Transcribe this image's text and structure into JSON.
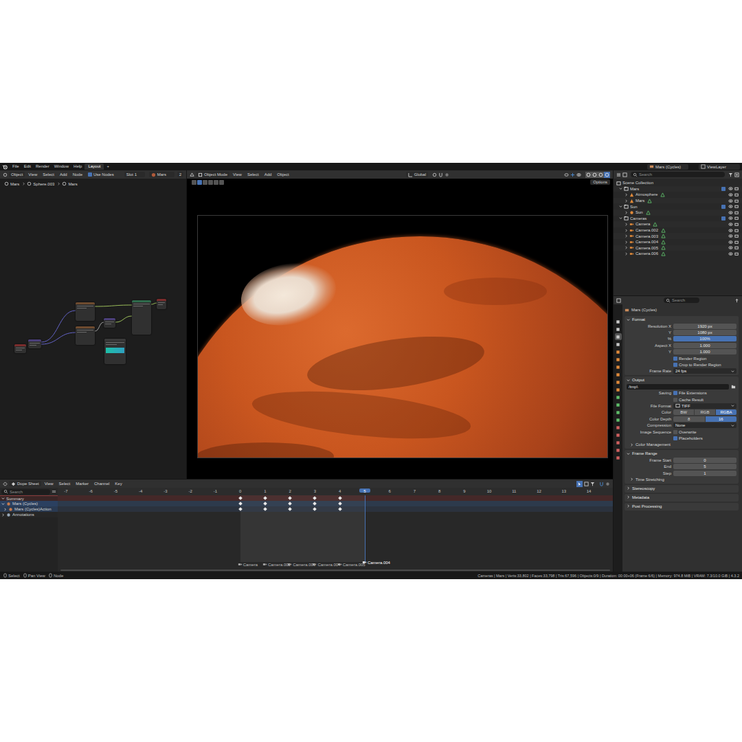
{
  "topbar": {
    "menus": [
      "File",
      "Edit",
      "Render",
      "Window",
      "Help"
    ],
    "workspace_tabs": [
      {
        "label": "Layout",
        "selected": true
      }
    ],
    "add_tab": "+",
    "scene": "Mars (Cycles)",
    "view_layer": "ViewLayer"
  },
  "node_editor": {
    "header": {
      "mode": "Object",
      "menus": [
        "View",
        "Select",
        "Add",
        "Node"
      ],
      "use_nodes": {
        "label": "Use Nodes",
        "checked": true
      },
      "slot": "Slot 1",
      "material": "Mars",
      "users": "2"
    },
    "breadcrumb": [
      "Mars",
      "Sphere.003",
      "Mars"
    ],
    "nodes": [
      {
        "color": "#6e4b2f"
      },
      {
        "color": "#6e4b2f"
      },
      {
        "color": "#4b3f7a"
      },
      {
        "color": "#2f6b4c"
      },
      {
        "color": "#7a2c2c"
      },
      {
        "color": "#4b3f7a"
      },
      {
        "color": "#7a2c2c"
      },
      {
        "color": "#3a3a3a"
      }
    ],
    "links": [
      {
        "color": "#9bbd5a"
      },
      {
        "color": "#6363c7"
      },
      {
        "color": "#6363c7"
      },
      {
        "color": "#a1a1a1"
      },
      {
        "color": "#9bbd5a"
      },
      {
        "color": "#9bbd5a"
      }
    ]
  },
  "viewport": {
    "header": {
      "mode": "Object Mode",
      "menus": [
        "View",
        "Select",
        "Add",
        "Object"
      ],
      "orientation": "Global"
    },
    "options": "Options",
    "shading": [
      {
        "selected": false
      },
      {
        "selected": false
      },
      {
        "selected": false
      },
      {
        "selected": true
      }
    ]
  },
  "outliner": {
    "search": {
      "placeholder": "Search"
    },
    "root": "Scene Collection",
    "items": [
      {
        "label": "Mars",
        "kind": "collection",
        "depth": 0,
        "expanded": true
      },
      {
        "label": "Atmosphere",
        "kind": "mesh",
        "depth": 1,
        "expanded": false
      },
      {
        "label": "Mars",
        "kind": "mesh",
        "depth": 1,
        "expanded": false
      },
      {
        "label": "Sun",
        "kind": "collection",
        "depth": 0,
        "expanded": true
      },
      {
        "label": "Sun",
        "kind": "light",
        "depth": 1,
        "expanded": false
      },
      {
        "label": "Cameras",
        "kind": "collection",
        "depth": 0,
        "expanded": true
      },
      {
        "label": "Camera",
        "kind": "camera",
        "depth": 1,
        "expanded": false
      },
      {
        "label": "Camera.002",
        "kind": "camera",
        "depth": 1,
        "expanded": false
      },
      {
        "label": "Camera.003",
        "kind": "camera",
        "depth": 1,
        "expanded": false
      },
      {
        "label": "Camera.004",
        "kind": "camera",
        "depth": 1,
        "expanded": false
      },
      {
        "label": "Camera.005",
        "kind": "camera",
        "depth": 1,
        "expanded": false
      },
      {
        "label": "Camera.006",
        "kind": "camera",
        "depth": 1,
        "expanded": false
      }
    ]
  },
  "properties": {
    "search": {
      "placeholder": "Search"
    },
    "title": "Mars (Cycles)",
    "tabs": [
      {
        "selected": false
      },
      {
        "selected": false
      },
      {
        "selected": true
      },
      {
        "selected": false
      },
      {
        "selected": false
      },
      {
        "selected": false
      },
      {
        "selected": false
      },
      {
        "selected": false
      },
      {
        "selected": false
      },
      {
        "selected": false
      },
      {
        "selected": false
      },
      {
        "selected": false
      },
      {
        "selected": false
      },
      {
        "selected": false
      },
      {
        "selected": false
      },
      {
        "selected": false
      },
      {
        "selected": false
      },
      {
        "selected": false
      },
      {
        "selected": false
      }
    ],
    "sections": [
      {
        "title": "Format",
        "expanded": true,
        "rows": [
          {
            "kind": "field",
            "label": "Resolution X",
            "value": "1920 px"
          },
          {
            "kind": "field",
            "label": "Y",
            "value": "1080 px"
          },
          {
            "kind": "slider",
            "label": "%",
            "value": "100%",
            "level": 1
          },
          {
            "kind": "field",
            "label": "Aspect X",
            "value": "1.000"
          },
          {
            "kind": "field",
            "label": "Y",
            "value": "1.000"
          },
          {
            "kind": "check",
            "label": "",
            "text": "Render Region",
            "checked": true
          },
          {
            "kind": "check",
            "label": "",
            "text": "Crop to Render Region",
            "checked": true
          },
          {
            "kind": "select",
            "label": "Frame Rate",
            "value": "24 fps"
          }
        ]
      },
      {
        "title": "Output",
        "expanded": true,
        "rows": [
          {
            "kind": "path",
            "label": "",
            "value": "/tmp\\"
          },
          {
            "kind": "check",
            "label": "Saving",
            "text": "File Extensions",
            "checked": true
          },
          {
            "kind": "check",
            "label": "",
            "text": "Cache Result",
            "checked": false
          },
          {
            "kind": "select",
            "label": "File Format",
            "value": "TIFF"
          },
          {
            "kind": "toggle",
            "label": "Color",
            "options": [
              {
                "label": "BW",
                "selected": false
              },
              {
                "label": "RGB",
                "selected": false
              },
              {
                "label": "RGBA",
                "selected": true
              }
            ]
          },
          {
            "kind": "toggle",
            "label": "Color Depth",
            "options": [
              {
                "label": "8",
                "selected": false
              },
              {
                "label": "16",
                "selected": true
              }
            ]
          },
          {
            "kind": "select",
            "label": "Compression",
            "value": "None"
          },
          {
            "kind": "check",
            "label": "Image Sequence",
            "text": "Overwrite",
            "checked": false
          },
          {
            "kind": "check",
            "label": "",
            "text": "Placeholders",
            "checked": true
          },
          {
            "kind": "sub",
            "label": "Color Management",
            "expanded": false
          }
        ]
      },
      {
        "title": "Frame Range",
        "expanded": true,
        "rows": [
          {
            "kind": "field",
            "label": "Frame Start",
            "value": "0"
          },
          {
            "kind": "field",
            "label": "End",
            "value": "5"
          },
          {
            "kind": "field",
            "label": "Step",
            "value": "1"
          },
          {
            "kind": "sub",
            "label": "Time Stretching",
            "expanded": false
          }
        ]
      },
      {
        "title": "Stereoscopy",
        "expanded": false,
        "rows": []
      },
      {
        "title": "Metadata",
        "expanded": false,
        "rows": []
      },
      {
        "title": "Post Processing",
        "expanded": false,
        "rows": []
      }
    ]
  },
  "dope_sheet": {
    "header": {
      "mode": "Dope Sheet",
      "menus": [
        "View",
        "Select",
        "Marker",
        "Channel",
        "Key"
      ]
    },
    "search": {
      "placeholder": "Search"
    },
    "frames": [
      {
        "label": "-7",
        "selected": false
      },
      {
        "label": "-6",
        "selected": false
      },
      {
        "label": "-5",
        "selected": false
      },
      {
        "label": "-4",
        "selected": false
      },
      {
        "label": "-3",
        "selected": false
      },
      {
        "label": "-2",
        "selected": false
      },
      {
        "label": "-1",
        "selected": false
      },
      {
        "label": "0",
        "selected": false
      },
      {
        "label": "1",
        "selected": false
      },
      {
        "label": "2",
        "selected": false
      },
      {
        "label": "3",
        "selected": false
      },
      {
        "label": "4",
        "selected": false
      },
      {
        "label": "5",
        "selected": true
      },
      {
        "label": "6",
        "selected": false
      },
      {
        "label": "7",
        "selected": false
      },
      {
        "label": "8",
        "selected": false
      },
      {
        "label": "9",
        "selected": false
      },
      {
        "label": "10",
        "selected": false
      },
      {
        "label": "11",
        "selected": false
      },
      {
        "label": "12",
        "selected": false
      },
      {
        "label": "13",
        "selected": false
      },
      {
        "label": "14",
        "selected": false
      }
    ],
    "frame_range": {
      "start": 0,
      "end": 5
    },
    "channels": [
      {
        "label": "Summary",
        "kind": "summary",
        "expanded": true,
        "keys": [
          0,
          1,
          2,
          3,
          4
        ]
      },
      {
        "label": "Mars (Cycles)",
        "kind": "object",
        "expanded": true,
        "keys": [
          0,
          1,
          2,
          3,
          4
        ]
      },
      {
        "label": "Mars (Cycles)Action",
        "kind": "action",
        "expanded": false,
        "keys": [
          0,
          1,
          2,
          3,
          4
        ]
      },
      {
        "label": "Annotations",
        "kind": "annotations",
        "expanded": false,
        "keys": []
      }
    ],
    "markers": [
      {
        "label": "Camera",
        "frame": 0,
        "selected": false
      },
      {
        "label": "Camera.002",
        "frame": 1,
        "selected": false
      },
      {
        "label": "Camera.003",
        "frame": 2,
        "selected": false
      },
      {
        "label": "Camera.004",
        "frame": 3,
        "selected": false
      },
      {
        "label": "Camera.005",
        "frame": 4,
        "selected": false
      },
      {
        "label": "Camera.004",
        "frame": 5,
        "selected": true
      }
    ]
  },
  "status_bar": {
    "left": [
      "Select",
      "Pan View",
      "Node"
    ],
    "right": "Cameras | Mars | Verts:33,802 | Faces:33,798 | Tris:67,596 | Objects:0/9 | Duration: 00:00+06 (Frame 6/6) | Memory: 974.8 MiB | VRAM: 7.3/10.0 GiB | 4.3.2"
  }
}
